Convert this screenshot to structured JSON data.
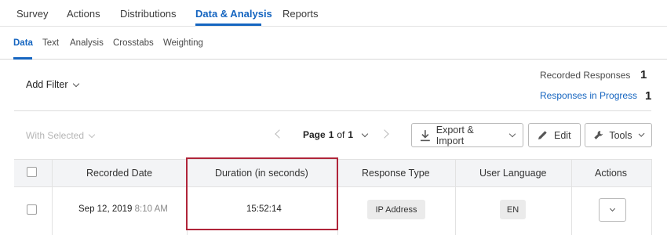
{
  "topnav": {
    "tabs": [
      {
        "label": "Survey"
      },
      {
        "label": "Actions"
      },
      {
        "label": "Distributions"
      },
      {
        "label": "Data & Analysis"
      },
      {
        "label": "Reports"
      }
    ],
    "active_tab": "Data & Analysis"
  },
  "subnav": {
    "tabs": [
      {
        "label": "Data"
      },
      {
        "label": "Text"
      },
      {
        "label": "Analysis"
      },
      {
        "label": "Crosstabs"
      },
      {
        "label": "Weighting"
      }
    ],
    "active_tab": "Data"
  },
  "filter": {
    "add_filter_label": "Add Filter"
  },
  "stats": {
    "recorded_label": "Recorded Responses",
    "recorded_count": "1",
    "in_progress_label": "Responses in Progress",
    "in_progress_count": "1"
  },
  "toolbar": {
    "with_selected_label": "With Selected",
    "page_word": "Page",
    "current_page": "1",
    "of_word": "of",
    "total_pages": "1",
    "export_label": "Export & Import",
    "edit_label": "Edit",
    "tools_label": "Tools"
  },
  "table": {
    "headers": [
      "Recorded Date",
      "Duration (in seconds)",
      "Response Type",
      "User Language",
      "Actions"
    ],
    "rows": [
      {
        "date": "Sep 12, 2019",
        "time": "8:10 AM",
        "duration": "15:52:14",
        "response_type": "IP Address",
        "language": "EN"
      }
    ]
  },
  "colors": {
    "accent": "#1565c0",
    "highlight": "#b0253a",
    "header_bg": "#f3f4f6"
  },
  "icons": [
    "chevron-down-icon",
    "chevron-left-icon",
    "chevron-right-icon",
    "download-icon",
    "pencil-icon",
    "wrench-icon"
  ]
}
